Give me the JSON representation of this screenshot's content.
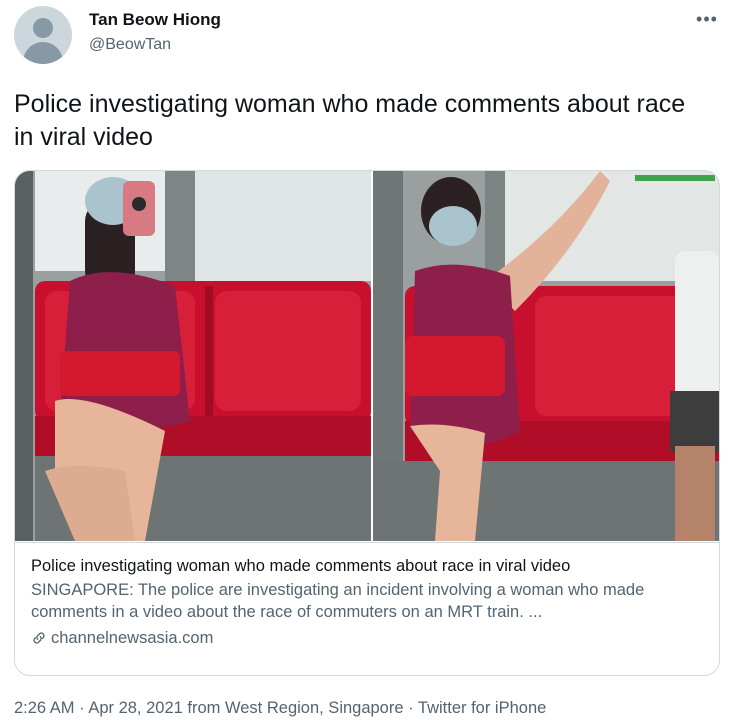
{
  "author": {
    "display_name": "Tan Beow Hiong",
    "handle": "@BeowTan"
  },
  "tweet": {
    "text": "Police investigating woman who made comments about race in viral video"
  },
  "card": {
    "title": "Police investigating woman who made comments about race in viral video",
    "description": "SINGAPORE: The police are investigating an incident involving a woman who made comments in a video about the race of commuters on an MRT train. ...",
    "domain": "channelnewsasia.com"
  },
  "meta": {
    "time": "2:26 AM",
    "sep1": " · ",
    "date": "Apr 28, 2021",
    "location": " from West Region, Singapore",
    "sep2": " · ",
    "client": "Twitter for iPhone"
  },
  "icons": {
    "more": "more-icon",
    "link": "link-icon",
    "avatar": "default-avatar"
  },
  "colors": {
    "text_primary": "#0f1419",
    "text_secondary": "#536471",
    "border": "#cfd9de",
    "seat_red": "#c8102e"
  }
}
